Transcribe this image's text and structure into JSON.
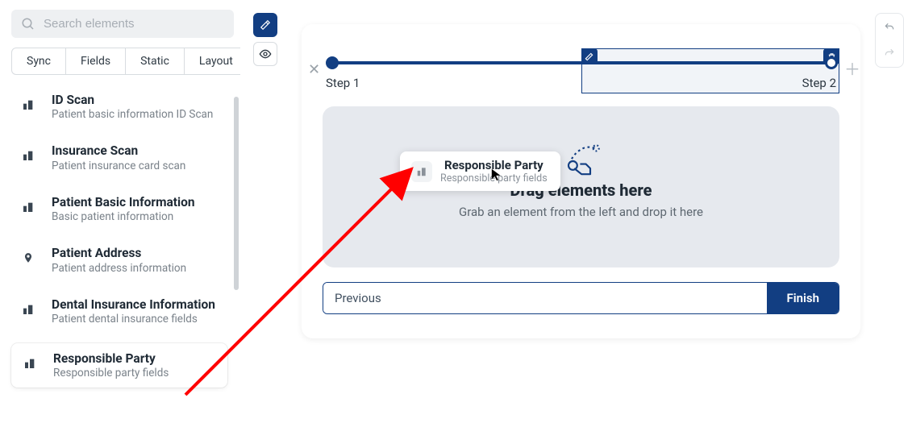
{
  "sidebar": {
    "search_placeholder": "Search elements",
    "tabs": [
      "Sync",
      "Fields",
      "Static",
      "Layout"
    ],
    "items": [
      {
        "title": "ID Scan",
        "desc": "Patient basic information ID Scan",
        "icon": "building-icon"
      },
      {
        "title": "Insurance Scan",
        "desc": "Patient insurance card scan",
        "icon": "building-icon"
      },
      {
        "title": "Patient Basic Information",
        "desc": "Basic patient information",
        "icon": "building-icon"
      },
      {
        "title": "Patient Address",
        "desc": "Patient address information",
        "icon": "pin-icon"
      },
      {
        "title": "Dental Insurance Information",
        "desc": "Patient dental insurance fields",
        "icon": "building-icon"
      },
      {
        "title": "Responsible Party",
        "desc": "Responsible party fields",
        "icon": "building-icon"
      }
    ]
  },
  "canvas": {
    "steps": [
      {
        "label": "Step 1"
      },
      {
        "label": "Step 2"
      }
    ],
    "dropzone": {
      "title": "Drag elements here",
      "subtitle": "Grab an element from the left and drop it here"
    },
    "drag_preview": {
      "title": "Responsible Party",
      "desc": "Responsible party fields"
    },
    "nav": {
      "prev": "Previous",
      "finish": "Finish"
    }
  },
  "colors": {
    "primary": "#123e82",
    "annotation": "#ff0000"
  }
}
